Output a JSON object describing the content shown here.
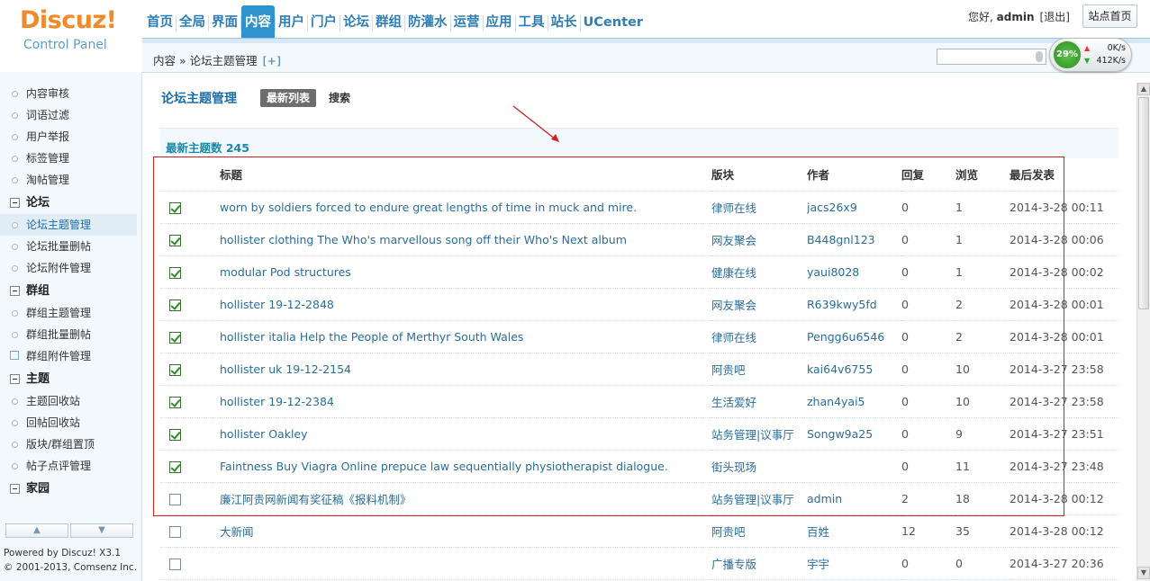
{
  "logo": {
    "main": "Discuz!",
    "sub": "Control Panel"
  },
  "nav": [
    {
      "label": "首页"
    },
    {
      "label": "全局"
    },
    {
      "label": "界面"
    },
    {
      "label": "内容",
      "active": true
    },
    {
      "label": "用户"
    },
    {
      "label": "门户"
    },
    {
      "label": "论坛"
    },
    {
      "label": "群组"
    },
    {
      "label": "防灌水"
    },
    {
      "label": "运营"
    },
    {
      "label": "应用"
    },
    {
      "label": "工具"
    },
    {
      "label": "站长"
    },
    {
      "label": "UCenter"
    }
  ],
  "user": {
    "greeting": "您好,",
    "name": "admin",
    "logout": "[退出]",
    "home_button": "站点首页"
  },
  "breadcrumb": {
    "path": "内容 » 论坛主题管理",
    "add": "[+]"
  },
  "speed": {
    "percent": "29%",
    "up": "0K/s",
    "down": "412K/s"
  },
  "sidebar": {
    "items": [
      {
        "type": "item",
        "label": "内容审核"
      },
      {
        "type": "item",
        "label": "词语过滤"
      },
      {
        "type": "item",
        "label": "用户举报"
      },
      {
        "type": "item",
        "label": "标签管理"
      },
      {
        "type": "item",
        "label": "淘帖管理"
      },
      {
        "type": "group",
        "label": "论坛"
      },
      {
        "type": "item",
        "label": "论坛主题管理",
        "active": true
      },
      {
        "type": "item",
        "label": "论坛批量删帖"
      },
      {
        "type": "item",
        "label": "论坛附件管理"
      },
      {
        "type": "group",
        "label": "群组"
      },
      {
        "type": "item",
        "label": "群组主题管理"
      },
      {
        "type": "item",
        "label": "群组批量删帖"
      },
      {
        "type": "item",
        "label": "群组附件管理",
        "edit": true
      },
      {
        "type": "group",
        "label": "主题"
      },
      {
        "type": "item",
        "label": "主题回收站"
      },
      {
        "type": "item",
        "label": "回帖回收站"
      },
      {
        "type": "item",
        "label": "版块/群组置顶"
      },
      {
        "type": "item",
        "label": "帖子点评管理"
      },
      {
        "type": "group",
        "label": "家园"
      }
    ],
    "powered": "Powered by Discuz! X3.1",
    "copyright": "© 2001-2013, Comsenz Inc."
  },
  "page": {
    "title": "论坛主题管理",
    "tab_new": "最新列表",
    "tab_search": "搜索",
    "count_label": "最新主题数 245"
  },
  "table": {
    "headers": {
      "title": "标题",
      "forum": "版块",
      "author": "作者",
      "replies": "回复",
      "views": "浏览",
      "lastpost": "最后发表"
    },
    "rows": [
      {
        "checked": true,
        "title": "worn by soldiers forced to endure great lengths of time in muck and mire.",
        "forum": "律师在线",
        "author": "jacs26x9",
        "replies": "0",
        "views": "1",
        "lastpost": "2014-3-28 00:11"
      },
      {
        "checked": true,
        "title": "hollister clothing The Who's marvellous song off their Who's Next album",
        "forum": "网友聚会",
        "author": "B448gnl123",
        "replies": "0",
        "views": "1",
        "lastpost": "2014-3-28 00:06"
      },
      {
        "checked": true,
        "title": "modular Pod structures",
        "forum": "健康在线",
        "author": "yaui8028",
        "replies": "0",
        "views": "1",
        "lastpost": "2014-3-28 00:02"
      },
      {
        "checked": true,
        "title": "hollister 19-12-2848",
        "forum": "网友聚会",
        "author": "R639kwy5fd",
        "replies": "0",
        "views": "2",
        "lastpost": "2014-3-28 00:01"
      },
      {
        "checked": true,
        "title": "hollister italia Help the People of Merthyr South Wales",
        "forum": "律师在线",
        "author": "Pengg6u6546",
        "replies": "0",
        "views": "2",
        "lastpost": "2014-3-28 00:01"
      },
      {
        "checked": true,
        "title": "hollister uk 19-12-2154",
        "forum": "阿贵吧",
        "author": "kai64v6755",
        "replies": "0",
        "views": "10",
        "lastpost": "2014-3-27 23:58"
      },
      {
        "checked": true,
        "title": "hollister 19-12-2384",
        "forum": "生活爱好",
        "author": "zhan4yai5",
        "replies": "0",
        "views": "10",
        "lastpost": "2014-3-27 23:58"
      },
      {
        "checked": true,
        "title": "hollister Oakley",
        "forum": "站务管理|议事厅",
        "author": "Songw9a25",
        "replies": "0",
        "views": "9",
        "lastpost": "2014-3-27 23:51"
      },
      {
        "checked": true,
        "title": "Faintness Buy Viagra Online prepuce law sequentially physiotherapist dialogue.",
        "forum": "街头现场",
        "author": "",
        "replies": "0",
        "views": "11",
        "lastpost": "2014-3-27 23:48"
      },
      {
        "checked": false,
        "title": "廉江阿贵网新闻有奖征稿《报料机制》",
        "forum": "站务管理|议事厅",
        "author": "admin",
        "replies": "2",
        "views": "18",
        "lastpost": "2014-3-28 00:12"
      },
      {
        "checked": false,
        "title": "大新闻",
        "forum": "阿贵吧",
        "author": "百姓",
        "replies": "12",
        "views": "35",
        "lastpost": "2014-3-28 00:12"
      },
      {
        "checked": false,
        "title": "",
        "forum": "广播专版",
        "author": "宇宇",
        "replies": "0",
        "views": "0",
        "lastpost": "2014-3-27 20:36"
      }
    ]
  },
  "colors": {
    "accent": "#2e7db5",
    "nav_active": "#2f93cf",
    "logo": "#f08a2a",
    "highlight_box": "#d42020"
  }
}
